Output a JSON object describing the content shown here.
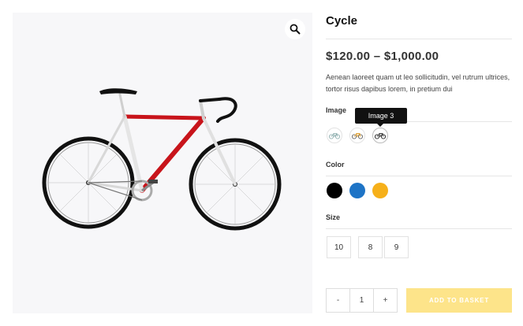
{
  "product": {
    "title": "Cycle",
    "price": "$120.00 – $1,000.00",
    "description": "Aenean laoreet quam ut leo sollicitudin, vel rutrum ultrices, tortor risus dapibus lorem, in pretium dui"
  },
  "gallery": {
    "zoom_icon": "magnifier-icon"
  },
  "attributes": {
    "image": {
      "label": "Image",
      "options": [
        "Image 1",
        "Image 2",
        "Image 3"
      ],
      "tooltip": "Image 3"
    },
    "color": {
      "label": "Color",
      "options": [
        {
          "name": "Black",
          "hex": "#000000"
        },
        {
          "name": "Blue",
          "hex": "#1e74c6"
        },
        {
          "name": "Yellow",
          "hex": "#f6b01a"
        }
      ]
    },
    "size": {
      "label": "Size",
      "options": [
        "10",
        "8",
        "9"
      ]
    }
  },
  "cart": {
    "minus": "-",
    "quantity": "1",
    "plus": "+",
    "button_label": "ADD TO BASKET",
    "button_color": "#fde48a"
  },
  "colors": {
    "bike_frame": "#c8141b"
  }
}
